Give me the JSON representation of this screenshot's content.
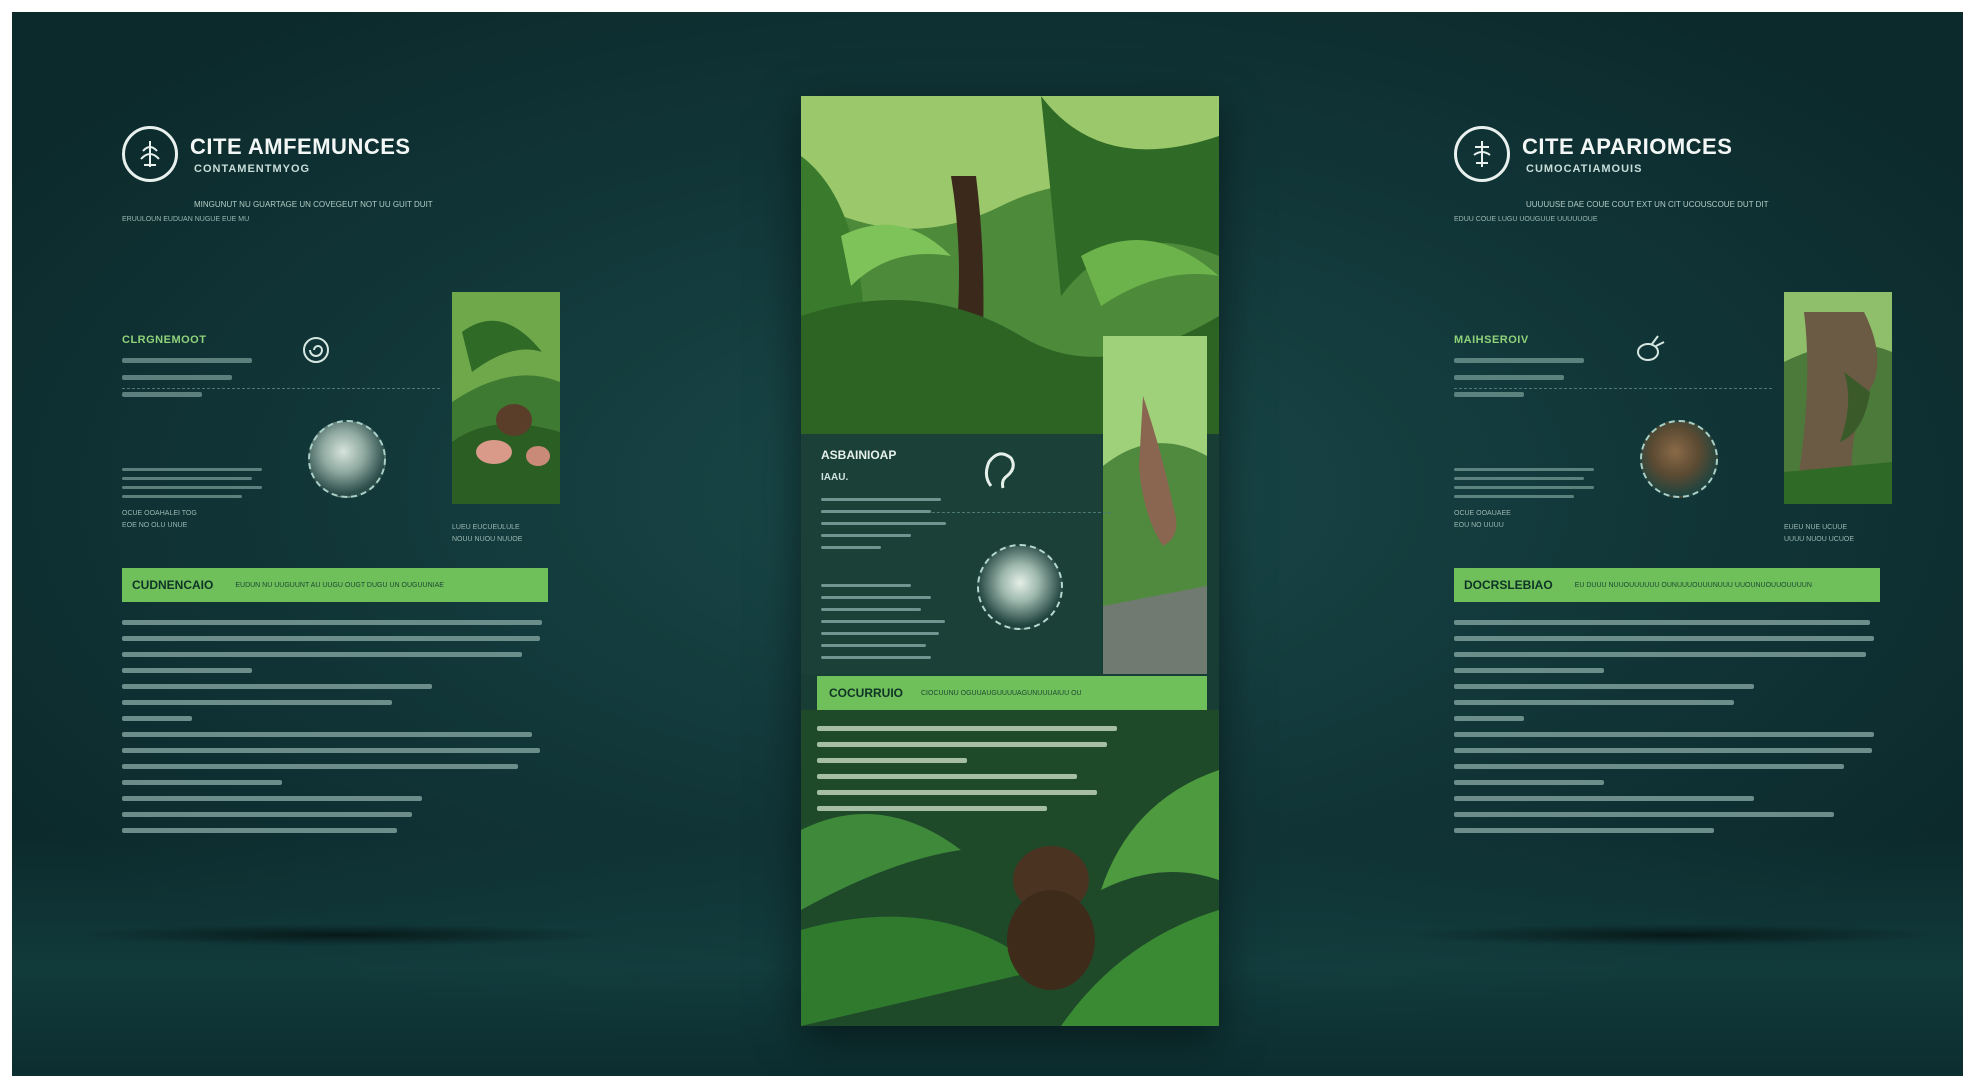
{
  "left_panel": {
    "title": "CITE AMFEMUNCES",
    "subtitle": "CONTAMENTMYOG",
    "tagline": "MINGUNUT NU GUARTAGE UN COVEGEUT NOT UU GUIT DUIT",
    "tagline2": "ERUULOUN   EUDUAN NUGUE EUE MU",
    "section_heading": "CLRGNEMOOT",
    "badge_caption": "OCUE OOAHALEI TOG\nEOE NO OLU UNUE",
    "photo_caption": "LUEU EUCUEULULE\nNOUU NUOU NUUOE",
    "bar_title": "CUDNENCAIO",
    "bar_subtitle": "EUDUN NU UUGUUNT AU UUGU OUGT DUGU UN OUGUUNIAE",
    "body_lines": 15
  },
  "center_panel": {
    "mid_title": "ASBAINIOAP",
    "mid_subtitle": "IAAU.",
    "bar_title": "COCURRUIO",
    "bar_subtitle": "CIOCUUNU OGUUAUGUUUUAGUNUUUAIUU OU"
  },
  "right_panel": {
    "title": "CITE APARIOMCES",
    "subtitle": "CUMOCATIAMOUIS",
    "tagline": "UUUUUSE DAE COUE COUT EXT UN CIT UCOUSCOUE DUT DIT",
    "tagline2": "EDUU COUE   LUGU UOUGUUE UUUUUOUE",
    "section_heading": "MAIHSEROIV",
    "badge_caption": "OCUE OOAUAEE\nEOU NO UUUU",
    "photo_caption": "EUEU NUE UCUUE\nUUUU NUOU UCUOE",
    "bar_title": "DOCRSLEBIAO",
    "bar_subtitle": "EU DUUU NUUOUUUUUU OUNUUUOUUUNUUU UUOUNUOUUOUUUUN",
    "body_lines": 15
  },
  "colors": {
    "background": "#133a3c",
    "accent_green": "#6fbf5a",
    "heading_green": "#8fd27a",
    "text_light": "#f2f7f5"
  }
}
